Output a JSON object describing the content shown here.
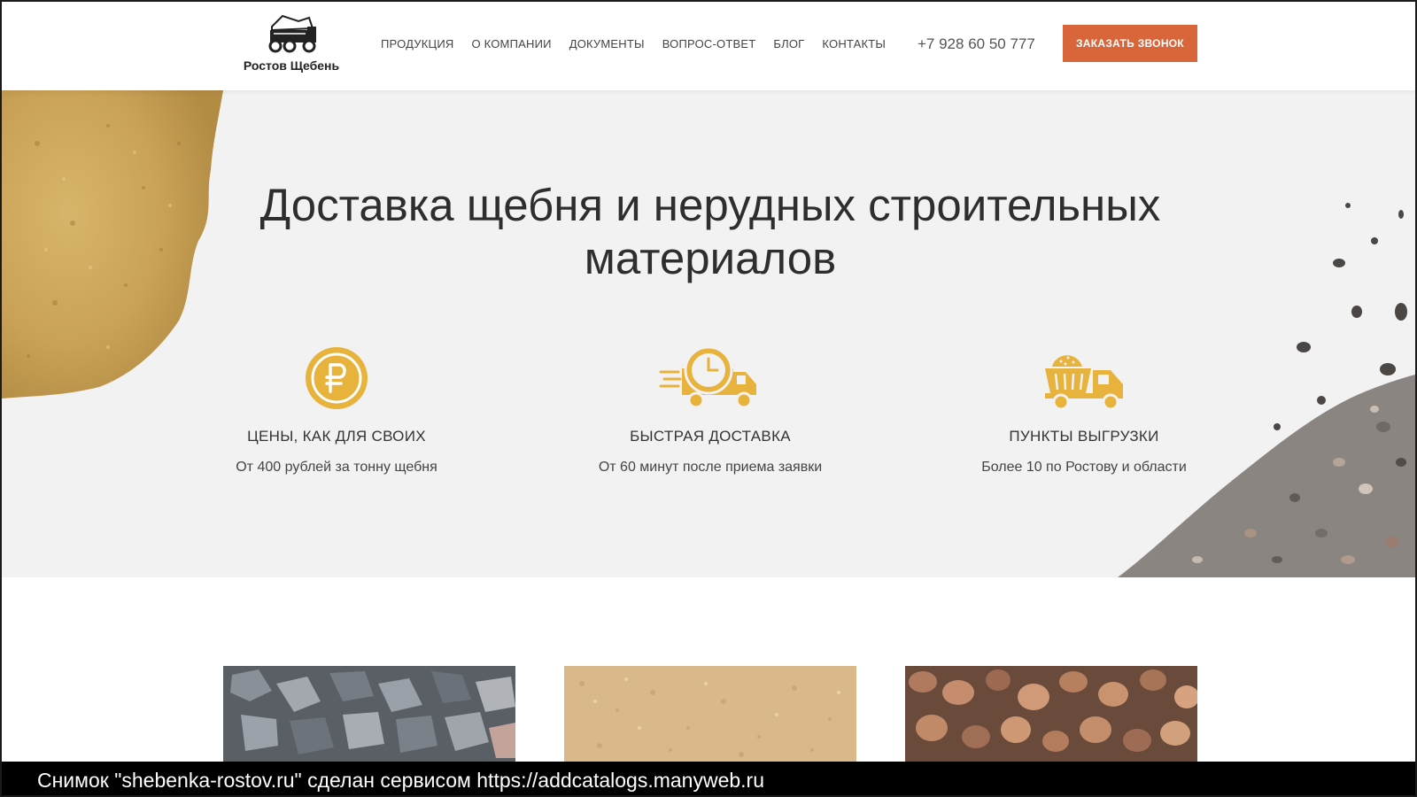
{
  "brand": {
    "name": "Ростов Щебень"
  },
  "nav": {
    "items": [
      {
        "label": "ПРОДУКЦИЯ"
      },
      {
        "label": "О КОМПАНИИ"
      },
      {
        "label": "ДОКУМЕНТЫ"
      },
      {
        "label": "ВОПРОС-ОТВЕТ"
      },
      {
        "label": "БЛОГ"
      },
      {
        "label": "КОНТАКТЫ"
      }
    ],
    "phone": "+7 928 60 50 777",
    "cta_label": "ЗАКАЗАТЬ ЗВОНОК"
  },
  "hero": {
    "title_line1": "Доставка щебня и нерудных строительных",
    "title_line2": "материалов",
    "features": [
      {
        "icon": "ruble-coin-icon",
        "title": "ЦЕНЫ, КАК ДЛЯ СВОИХ",
        "subtitle": "От 400 рублей за тонну щебня"
      },
      {
        "icon": "fast-delivery-truck-icon",
        "title": "БЫСТРАЯ ДОСТАВКА",
        "subtitle": "От 60 минут после приема заявки"
      },
      {
        "icon": "dump-truck-icon",
        "title": "ПУНКТЫ ВЫГРУЗКИ",
        "subtitle": "Более 10 по Ростову и области"
      }
    ]
  },
  "colors": {
    "accent": "#d9663a",
    "icon_gold": "#e8b33c",
    "hero_bg": "#f2f2f2"
  },
  "footer": {
    "caption": "Снимок \"shebenka-rostov.ru\" сделан сервисом https://addcatalogs.manyweb.ru"
  }
}
